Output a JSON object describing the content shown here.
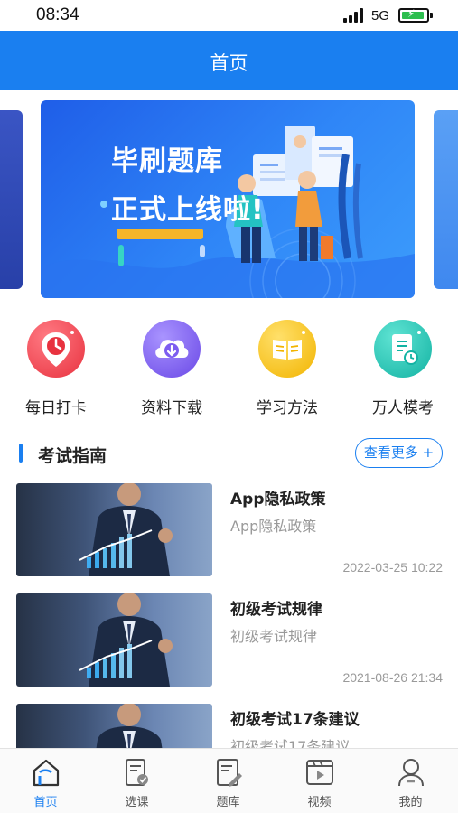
{
  "status_bar": {
    "time": "08:34",
    "network": "5G",
    "battery_color": "#2dbe4f"
  },
  "header": {
    "title": "首页"
  },
  "banner": {
    "line1": "毕刷题库",
    "line2": "正式上线啦!",
    "colors": {
      "bg_start": "#1f5ee8",
      "bg_end": "#3c9cfb"
    }
  },
  "quick_actions": [
    {
      "label": "每日打卡",
      "icon": "clock-pin-icon",
      "color": "#f04a55"
    },
    {
      "label": "资料下载",
      "icon": "cloud-download-icon",
      "color": "#7d5df0"
    },
    {
      "label": "学习方法",
      "icon": "book-icon",
      "color": "#f8c21a"
    },
    {
      "label": "万人模考",
      "icon": "document-clock-icon",
      "color": "#1fc7b6"
    }
  ],
  "guide": {
    "title": "考试指南",
    "more_label": "查看更多 +",
    "articles": [
      {
        "title": "App隐私政策",
        "subtitle": "App隐私政策",
        "date": "2022-03-25 10:22"
      },
      {
        "title": "初级考试规律",
        "subtitle": "初级考试规律",
        "date": "2021-08-26 21:34"
      },
      {
        "title": "初级考试17条建议",
        "subtitle": "初级考试17条建议",
        "date": ""
      }
    ]
  },
  "tabbar": {
    "active_color": "#1a7ff0",
    "items": [
      {
        "label": "首页",
        "icon": "home-icon",
        "active": true
      },
      {
        "label": "选课",
        "icon": "course-select-icon",
        "active": false
      },
      {
        "label": "题库",
        "icon": "question-bank-icon",
        "active": false
      },
      {
        "label": "视频",
        "icon": "video-icon",
        "active": false
      },
      {
        "label": "我的",
        "icon": "profile-icon",
        "active": false
      }
    ]
  }
}
